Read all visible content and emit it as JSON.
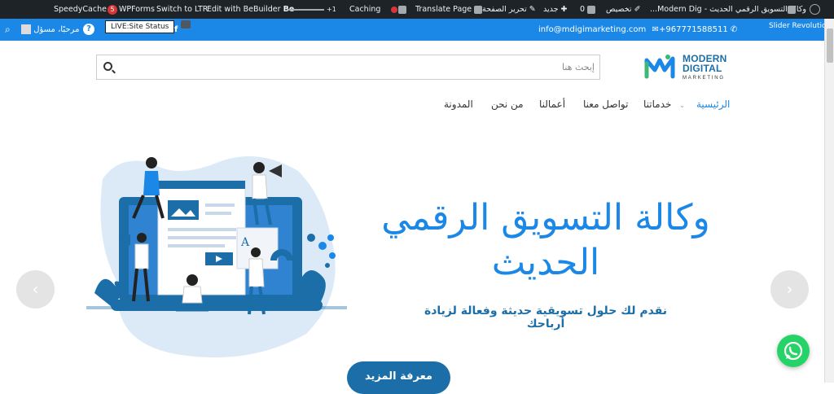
{
  "adminbar": {
    "speedycache": "SpeedyCache",
    "wpforms_count": "5",
    "wpforms": "WPForms",
    "switch_ltr": "Switch to LTR",
    "bebuilder": "Edit with BeBuilder",
    "bebuilder_icon": "Be",
    "counter": "+1",
    "caching": "Caching",
    "translate": "Translate Page",
    "edit_page": "تحرير الصفحة",
    "new": "جديد",
    "comments_count": "0",
    "customize": "تخصيص",
    "site_name": "وكالة التسويق الرقمي الحديث - Modern Dig..."
  },
  "topbar": {
    "greeting": "مرحبًا، مسؤل",
    "help": "?",
    "live_status": "LIVE:Site Status",
    "email": "info@mdigimarketing.com",
    "phone": "+967771588511",
    "slider": "Slider Revolution"
  },
  "search": {
    "placeholder": "إبحث هنا"
  },
  "logo": {
    "line1": "MODERN",
    "line2": "DIGITAL",
    "line3": "MARKETING"
  },
  "nav": {
    "home": "الرئيسية",
    "services": "خدماتنا",
    "contact": "تواصل معنا",
    "works": "أعمالنا",
    "about": "من نحن",
    "blog": "المدونة"
  },
  "hero": {
    "title_line1": "وكالة التسويق الرقمي",
    "title_line2": "الحديث",
    "subtitle": "نقدم لك حلول تسويقية حديثة وفعالة لزيادة أرباحك",
    "cta": "معرفة المزيد"
  },
  "colors": {
    "brand_blue": "#1b87e6",
    "dark_blue": "#1b6ea8",
    "admin_bar": "#1d2327",
    "whatsapp": "#25d366"
  },
  "icons": [
    "wordpress-icon",
    "search-icon",
    "help-icon",
    "facebook-icon",
    "phone-icon",
    "email-icon",
    "whatsapp-icon",
    "chevron-left-icon",
    "chevron-right-icon"
  ]
}
